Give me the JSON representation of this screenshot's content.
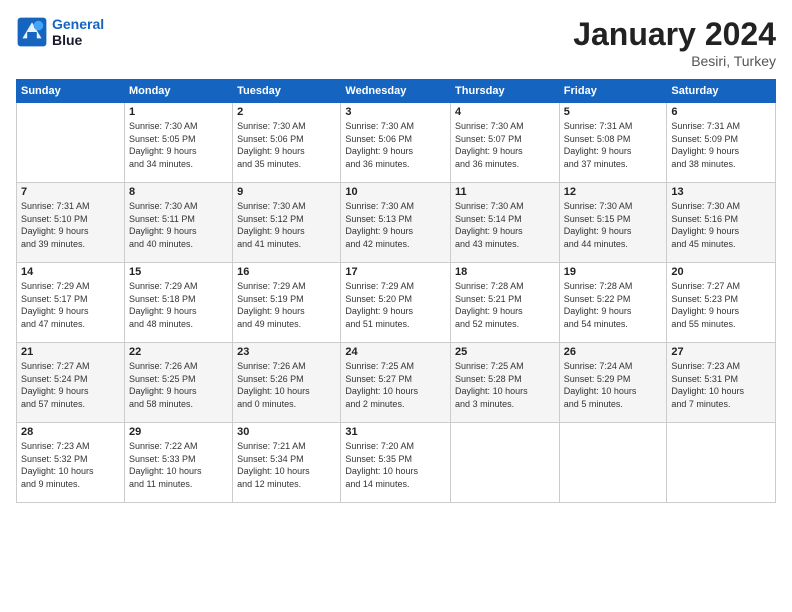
{
  "logo": {
    "line1": "General",
    "line2": "Blue"
  },
  "title": "January 2024",
  "location": "Besiri, Turkey",
  "days_of_week": [
    "Sunday",
    "Monday",
    "Tuesday",
    "Wednesday",
    "Thursday",
    "Friday",
    "Saturday"
  ],
  "weeks": [
    [
      {
        "day": "",
        "info": ""
      },
      {
        "day": "1",
        "info": "Sunrise: 7:30 AM\nSunset: 5:05 PM\nDaylight: 9 hours\nand 34 minutes."
      },
      {
        "day": "2",
        "info": "Sunrise: 7:30 AM\nSunset: 5:06 PM\nDaylight: 9 hours\nand 35 minutes."
      },
      {
        "day": "3",
        "info": "Sunrise: 7:30 AM\nSunset: 5:06 PM\nDaylight: 9 hours\nand 36 minutes."
      },
      {
        "day": "4",
        "info": "Sunrise: 7:30 AM\nSunset: 5:07 PM\nDaylight: 9 hours\nand 36 minutes."
      },
      {
        "day": "5",
        "info": "Sunrise: 7:31 AM\nSunset: 5:08 PM\nDaylight: 9 hours\nand 37 minutes."
      },
      {
        "day": "6",
        "info": "Sunrise: 7:31 AM\nSunset: 5:09 PM\nDaylight: 9 hours\nand 38 minutes."
      }
    ],
    [
      {
        "day": "7",
        "info": "Sunrise: 7:31 AM\nSunset: 5:10 PM\nDaylight: 9 hours\nand 39 minutes."
      },
      {
        "day": "8",
        "info": "Sunrise: 7:30 AM\nSunset: 5:11 PM\nDaylight: 9 hours\nand 40 minutes."
      },
      {
        "day": "9",
        "info": "Sunrise: 7:30 AM\nSunset: 5:12 PM\nDaylight: 9 hours\nand 41 minutes."
      },
      {
        "day": "10",
        "info": "Sunrise: 7:30 AM\nSunset: 5:13 PM\nDaylight: 9 hours\nand 42 minutes."
      },
      {
        "day": "11",
        "info": "Sunrise: 7:30 AM\nSunset: 5:14 PM\nDaylight: 9 hours\nand 43 minutes."
      },
      {
        "day": "12",
        "info": "Sunrise: 7:30 AM\nSunset: 5:15 PM\nDaylight: 9 hours\nand 44 minutes."
      },
      {
        "day": "13",
        "info": "Sunrise: 7:30 AM\nSunset: 5:16 PM\nDaylight: 9 hours\nand 45 minutes."
      }
    ],
    [
      {
        "day": "14",
        "info": "Sunrise: 7:29 AM\nSunset: 5:17 PM\nDaylight: 9 hours\nand 47 minutes."
      },
      {
        "day": "15",
        "info": "Sunrise: 7:29 AM\nSunset: 5:18 PM\nDaylight: 9 hours\nand 48 minutes."
      },
      {
        "day": "16",
        "info": "Sunrise: 7:29 AM\nSunset: 5:19 PM\nDaylight: 9 hours\nand 49 minutes."
      },
      {
        "day": "17",
        "info": "Sunrise: 7:29 AM\nSunset: 5:20 PM\nDaylight: 9 hours\nand 51 minutes."
      },
      {
        "day": "18",
        "info": "Sunrise: 7:28 AM\nSunset: 5:21 PM\nDaylight: 9 hours\nand 52 minutes."
      },
      {
        "day": "19",
        "info": "Sunrise: 7:28 AM\nSunset: 5:22 PM\nDaylight: 9 hours\nand 54 minutes."
      },
      {
        "day": "20",
        "info": "Sunrise: 7:27 AM\nSunset: 5:23 PM\nDaylight: 9 hours\nand 55 minutes."
      }
    ],
    [
      {
        "day": "21",
        "info": "Sunrise: 7:27 AM\nSunset: 5:24 PM\nDaylight: 9 hours\nand 57 minutes."
      },
      {
        "day": "22",
        "info": "Sunrise: 7:26 AM\nSunset: 5:25 PM\nDaylight: 9 hours\nand 58 minutes."
      },
      {
        "day": "23",
        "info": "Sunrise: 7:26 AM\nSunset: 5:26 PM\nDaylight: 10 hours\nand 0 minutes."
      },
      {
        "day": "24",
        "info": "Sunrise: 7:25 AM\nSunset: 5:27 PM\nDaylight: 10 hours\nand 2 minutes."
      },
      {
        "day": "25",
        "info": "Sunrise: 7:25 AM\nSunset: 5:28 PM\nDaylight: 10 hours\nand 3 minutes."
      },
      {
        "day": "26",
        "info": "Sunrise: 7:24 AM\nSunset: 5:29 PM\nDaylight: 10 hours\nand 5 minutes."
      },
      {
        "day": "27",
        "info": "Sunrise: 7:23 AM\nSunset: 5:31 PM\nDaylight: 10 hours\nand 7 minutes."
      }
    ],
    [
      {
        "day": "28",
        "info": "Sunrise: 7:23 AM\nSunset: 5:32 PM\nDaylight: 10 hours\nand 9 minutes."
      },
      {
        "day": "29",
        "info": "Sunrise: 7:22 AM\nSunset: 5:33 PM\nDaylight: 10 hours\nand 11 minutes."
      },
      {
        "day": "30",
        "info": "Sunrise: 7:21 AM\nSunset: 5:34 PM\nDaylight: 10 hours\nand 12 minutes."
      },
      {
        "day": "31",
        "info": "Sunrise: 7:20 AM\nSunset: 5:35 PM\nDaylight: 10 hours\nand 14 minutes."
      },
      {
        "day": "",
        "info": ""
      },
      {
        "day": "",
        "info": ""
      },
      {
        "day": "",
        "info": ""
      }
    ]
  ]
}
